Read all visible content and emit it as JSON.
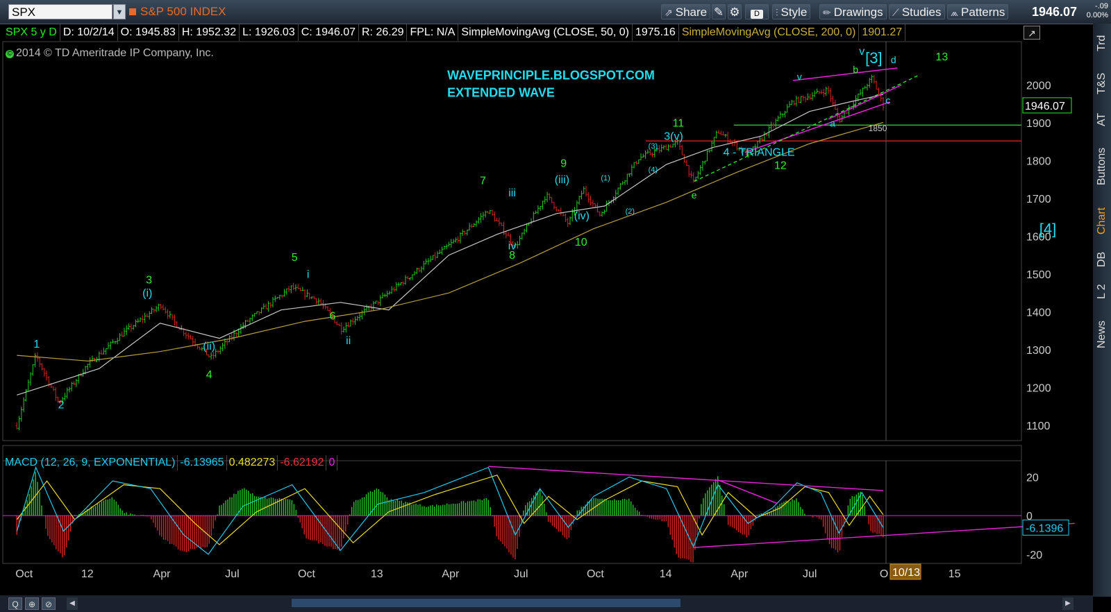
{
  "toolbar": {
    "symbol": "SPX",
    "index_name": "S&P 500 INDEX",
    "share": "Share",
    "d_badge": "D",
    "style": "Style",
    "drawings": "Drawings",
    "studies": "Studies",
    "patterns": "Patterns",
    "last_price": "1946.07",
    "change": "-.09",
    "change_pct": "0.00%"
  },
  "studybar": {
    "symbol_period": "SPX 5 y D",
    "date": "D: 10/2/14",
    "open": "O: 1945.83",
    "high": "H: 1952.32",
    "low": "L: 1926.03",
    "close": "C: 1946.07",
    "range": "R: 26.29",
    "fpl": "FPL: N/A",
    "sma50_label": "SimpleMovingAvg (CLOSE, 50, 0)",
    "sma50_value": "1975.16",
    "sma200_label": "SimpleMovingAvg (CLOSE, 200, 0)",
    "sma200_value": "1901.27"
  },
  "copyright": "2014 © TD Ameritrade IP Company, Inc.",
  "copyright_prefix": "©",
  "macd_bar": {
    "label": "MACD (12, 26, 9, EXPONENTIAL)",
    "value": "-6.13965",
    "avg": "0.482273",
    "diff": "-6.62192",
    "zero": "0"
  },
  "right_tabs": [
    "Trd",
    "T&S",
    "AT",
    "Buttons",
    "Chart",
    "DB",
    "L 2",
    "News"
  ],
  "bottom_buttons": [
    "Q",
    "⊕",
    "⊘"
  ],
  "colors": {
    "price_bar_up": "#22cc22",
    "price_bar_down": "#dd2222",
    "sma50": "#c8c8c8",
    "sma200": "#b8a040",
    "magenta": "#ee22dd",
    "cyan": "#22ddee",
    "green_label": "#33ee33",
    "macd_line": "#22ccee",
    "signal_line": "#eedd22"
  },
  "chart_data": [
    {
      "type": "line",
      "title": "S&P 500 INDEX",
      "x_tick_labels": [
        "Oct",
        "12",
        "Apr",
        "Jul",
        "Oct",
        "13",
        "Apr",
        "Jul",
        "Oct",
        "14",
        "Apr",
        "Jul",
        "O",
        "15"
      ],
      "x_highlight_label": "10/13",
      "y_tick_labels": [
        "1100",
        "1200",
        "1300",
        "1400",
        "1500",
        "1600",
        "1700",
        "1800",
        "1900",
        "2000"
      ],
      "ylim": [
        1065,
        2100
      ],
      "current_price_label": "1946.07",
      "series": [
        {
          "name": "SPX",
          "x": [
            "2011-10-03",
            "2011-10-27",
            "2011-11-25",
            "2011-12-30",
            "2012-02-15",
            "2012-04-02",
            "2012-04-20",
            "2012-06-04",
            "2012-07-20",
            "2012-09-14",
            "2012-10-18",
            "2012-11-16",
            "2012-12-31",
            "2013-02-20",
            "2013-04-10",
            "2013-05-21",
            "2013-06-24",
            "2013-08-02",
            "2013-08-30",
            "2013-09-18",
            "2013-10-09",
            "2013-11-27",
            "2014-01-15",
            "2014-02-04",
            "2014-03-07",
            "2014-04-14",
            "2014-06-09",
            "2014-07-24",
            "2014-08-07",
            "2014-09-18",
            "2014-10-02"
          ],
          "values": [
            1099,
            1285,
            1159,
            1257,
            1345,
            1419,
            1370,
            1278,
            1375,
            1465,
            1430,
            1355,
            1426,
            1510,
            1590,
            1669,
            1573,
            1709,
            1633,
            1725,
            1656,
            1807,
            1848,
            1741,
            1878,
            1815,
            1955,
            1988,
            1905,
            2019,
            1946
          ]
        },
        {
          "name": "SimpleMovingAvg (CLOSE, 50, 0)",
          "x": [
            "2011-10-03",
            "2012-01-15",
            "2012-04-01",
            "2012-06-15",
            "2012-09-01",
            "2012-11-15",
            "2013-01-15",
            "2013-04-01",
            "2013-06-01",
            "2013-08-15",
            "2013-10-15",
            "2014-01-01",
            "2014-03-01",
            "2014-05-01",
            "2014-07-01",
            "2014-08-20",
            "2014-10-02"
          ],
          "values": [
            1180,
            1250,
            1370,
            1330,
            1405,
            1425,
            1405,
            1550,
            1605,
            1660,
            1680,
            1790,
            1835,
            1865,
            1930,
            1955,
            1975
          ]
        },
        {
          "name": "SimpleMovingAvg (CLOSE, 200, 0)",
          "x": [
            "2011-10-03",
            "2012-01-01",
            "2012-04-01",
            "2012-07-01",
            "2012-10-01",
            "2013-01-01",
            "2013-04-01",
            "2013-07-01",
            "2013-10-01",
            "2014-01-01",
            "2014-04-01",
            "2014-07-01",
            "2014-10-02"
          ],
          "values": [
            1285,
            1270,
            1295,
            1330,
            1375,
            1405,
            1450,
            1530,
            1620,
            1690,
            1770,
            1845,
            1901
          ]
        }
      ],
      "annotations": [
        "WAVEPRINCIPLE.BLOGSPOT.COM",
        "EXTENDED WAVE",
        "4 - TRIANGLE",
        "1850",
        "[3]",
        "[4]",
        "1",
        "2",
        "3",
        "4",
        "5",
        "6",
        "7",
        "8",
        "9",
        "10",
        "11",
        "12",
        "13",
        "(i)",
        "(ii)",
        "(iii)",
        "(iv)",
        "3(v)",
        "(1)",
        "(2)",
        "(3)",
        "(4)",
        "i",
        "ii",
        "iii",
        "iv",
        "v",
        "a",
        "b",
        "c",
        "d",
        "e"
      ]
    },
    {
      "type": "line",
      "title": "MACD (12, 26, 9, EXPONENTIAL)",
      "y_tick_labels": [
        "20",
        "0",
        "-20"
      ],
      "ylim": [
        -24,
        27
      ],
      "current_value_label": "-6.1396",
      "series": [
        {
          "name": "MACD",
          "x": [
            "2011-10-03",
            "2011-10-27",
            "2011-12-01",
            "2012-02-01",
            "2012-03-20",
            "2012-05-01",
            "2012-06-01",
            "2012-07-15",
            "2012-09-15",
            "2012-11-15",
            "2013-01-01",
            "2013-03-01",
            "2013-05-21",
            "2013-06-24",
            "2013-07-25",
            "2013-08-30",
            "2013-10-01",
            "2013-11-15",
            "2014-01-01",
            "2014-02-04",
            "2014-03-07",
            "2014-04-14",
            "2014-05-15",
            "2014-06-15",
            "2014-07-15",
            "2014-08-07",
            "2014-09-05",
            "2014-10-02"
          ],
          "values": [
            -8,
            25,
            -8,
            18,
            14,
            -10,
            -20,
            5,
            16,
            -18,
            6,
            12,
            25,
            -10,
            14,
            -6,
            10,
            20,
            14,
            -16,
            16,
            -4,
            4,
            17,
            12,
            -9,
            12,
            -6.14
          ]
        },
        {
          "name": "Signal",
          "x": [
            "2011-10-03",
            "2011-11-10",
            "2011-12-15",
            "2012-02-15",
            "2012-04-01",
            "2012-05-15",
            "2012-06-15",
            "2012-08-01",
            "2012-10-01",
            "2012-12-01",
            "2013-01-15",
            "2013-03-15",
            "2013-06-01",
            "2013-07-05",
            "2013-08-05",
            "2013-09-10",
            "2013-10-15",
            "2013-12-01",
            "2014-01-15",
            "2014-02-15",
            "2014-03-20",
            "2014-04-25",
            "2014-05-25",
            "2014-06-25",
            "2014-07-25",
            "2014-08-20",
            "2014-09-15",
            "2014-10-02"
          ],
          "values": [
            -2,
            18,
            -2,
            16,
            14,
            -4,
            -15,
            2,
            14,
            -14,
            2,
            11,
            21,
            -4,
            10,
            -2,
            8,
            18,
            15,
            -10,
            12,
            -1,
            4,
            15,
            12,
            -5,
            10,
            0.48
          ]
        }
      ]
    }
  ]
}
